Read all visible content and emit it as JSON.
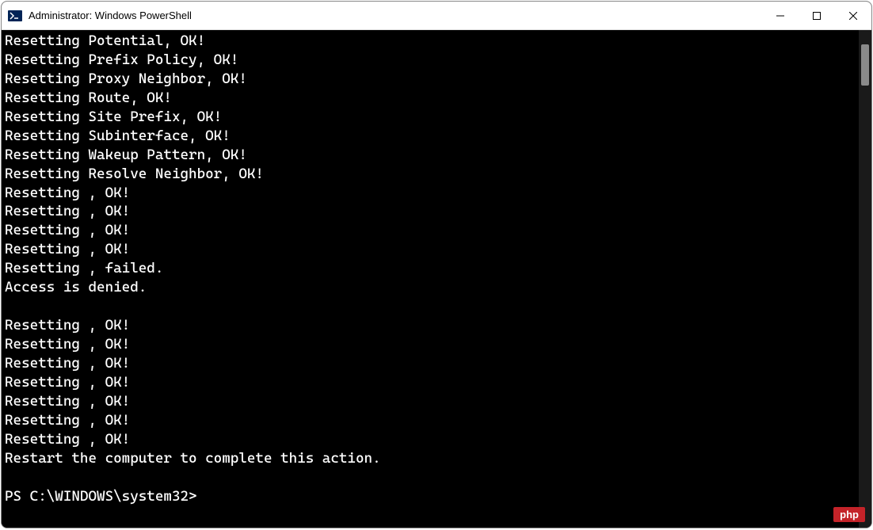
{
  "title": "Administrator: Windows PowerShell",
  "controls": {
    "minimize": "Minimize",
    "maximize": "Maximize",
    "close": "Close"
  },
  "terminal": {
    "lines": [
      "Resetting Potential, OK!",
      "Resetting Prefix Policy, OK!",
      "Resetting Proxy Neighbor, OK!",
      "Resetting Route, OK!",
      "Resetting Site Prefix, OK!",
      "Resetting Subinterface, OK!",
      "Resetting Wakeup Pattern, OK!",
      "Resetting Resolve Neighbor, OK!",
      "Resetting , OK!",
      "Resetting , OK!",
      "Resetting , OK!",
      "Resetting , OK!",
      "Resetting , failed.",
      "Access is denied.",
      "",
      "Resetting , OK!",
      "Resetting , OK!",
      "Resetting , OK!",
      "Resetting , OK!",
      "Resetting , OK!",
      "Resetting , OK!",
      "Resetting , OK!",
      "Restart the computer to complete this action.",
      "",
      "PS C:\\WINDOWS\\system32>"
    ]
  },
  "watermark": "php"
}
